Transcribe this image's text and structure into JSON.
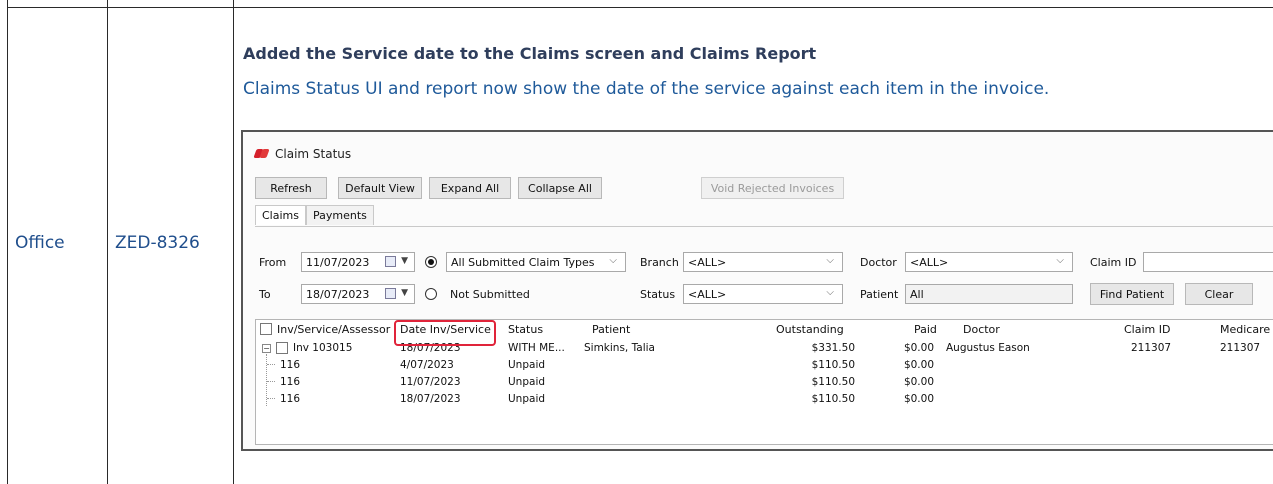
{
  "row": {
    "type": "Office",
    "id": "ZED-8326",
    "title": "Added the Service date to the Claims screen and Claims Report",
    "description": "Claims Status UI and report now show the date of the service against each item in the invoice."
  },
  "screenshot": {
    "window_title": "Claim Status",
    "toolbar": {
      "refresh": "Refresh",
      "default_view": "Default View",
      "expand_all": "Expand All",
      "collapse_all": "Collapse All",
      "void_rejected": "Void Rejected Invoices"
    },
    "tabs": [
      "Claims",
      "Payments"
    ],
    "filters": {
      "from_label": "From",
      "from_value": "11/07/2023",
      "to_label": "To",
      "to_value": "18/07/2023",
      "claim_types_value": "All Submitted Claim Types",
      "not_submitted_label": "Not Submitted",
      "branch_label": "Branch",
      "branch_value": "<ALL>",
      "status_label": "Status",
      "status_value": "<ALL>",
      "doctor_label": "Doctor",
      "doctor_value": "<ALL>",
      "patient_label": "Patient",
      "patient_value": "All",
      "claim_id_label": "Claim ID",
      "claim_id_value": "",
      "find_patient": "Find Patient",
      "clear": "Clear"
    },
    "grid": {
      "headers": {
        "inv": "Inv/Service/Assessor",
        "date": "Date Inv/Service",
        "status": "Status",
        "patient": "Patient",
        "outstanding": "Outstanding",
        "paid": "Paid",
        "doctor": "Doctor",
        "claim_id": "Claim ID",
        "medicare": "Medicare"
      },
      "rows": [
        {
          "inv": "Inv 103015",
          "date": "18/07/2023",
          "status": "WITH ME...",
          "patient": "Simkins, Talia",
          "outstanding": "$331.50",
          "paid": "$0.00",
          "doctor": "Augustus Eason",
          "claim_id": "211307",
          "medicare": "211307"
        },
        {
          "inv": "116",
          "date": "4/07/2023",
          "status": "Unpaid",
          "patient": "",
          "outstanding": "$110.50",
          "paid": "$0.00",
          "doctor": "",
          "claim_id": "",
          "medicare": ""
        },
        {
          "inv": "116",
          "date": "11/07/2023",
          "status": "Unpaid",
          "patient": "",
          "outstanding": "$110.50",
          "paid": "$0.00",
          "doctor": "",
          "claim_id": "",
          "medicare": ""
        },
        {
          "inv": "116",
          "date": "18/07/2023",
          "status": "Unpaid",
          "patient": "",
          "outstanding": "$110.50",
          "paid": "$0.00",
          "doctor": "",
          "claim_id": "",
          "medicare": ""
        }
      ]
    }
  }
}
